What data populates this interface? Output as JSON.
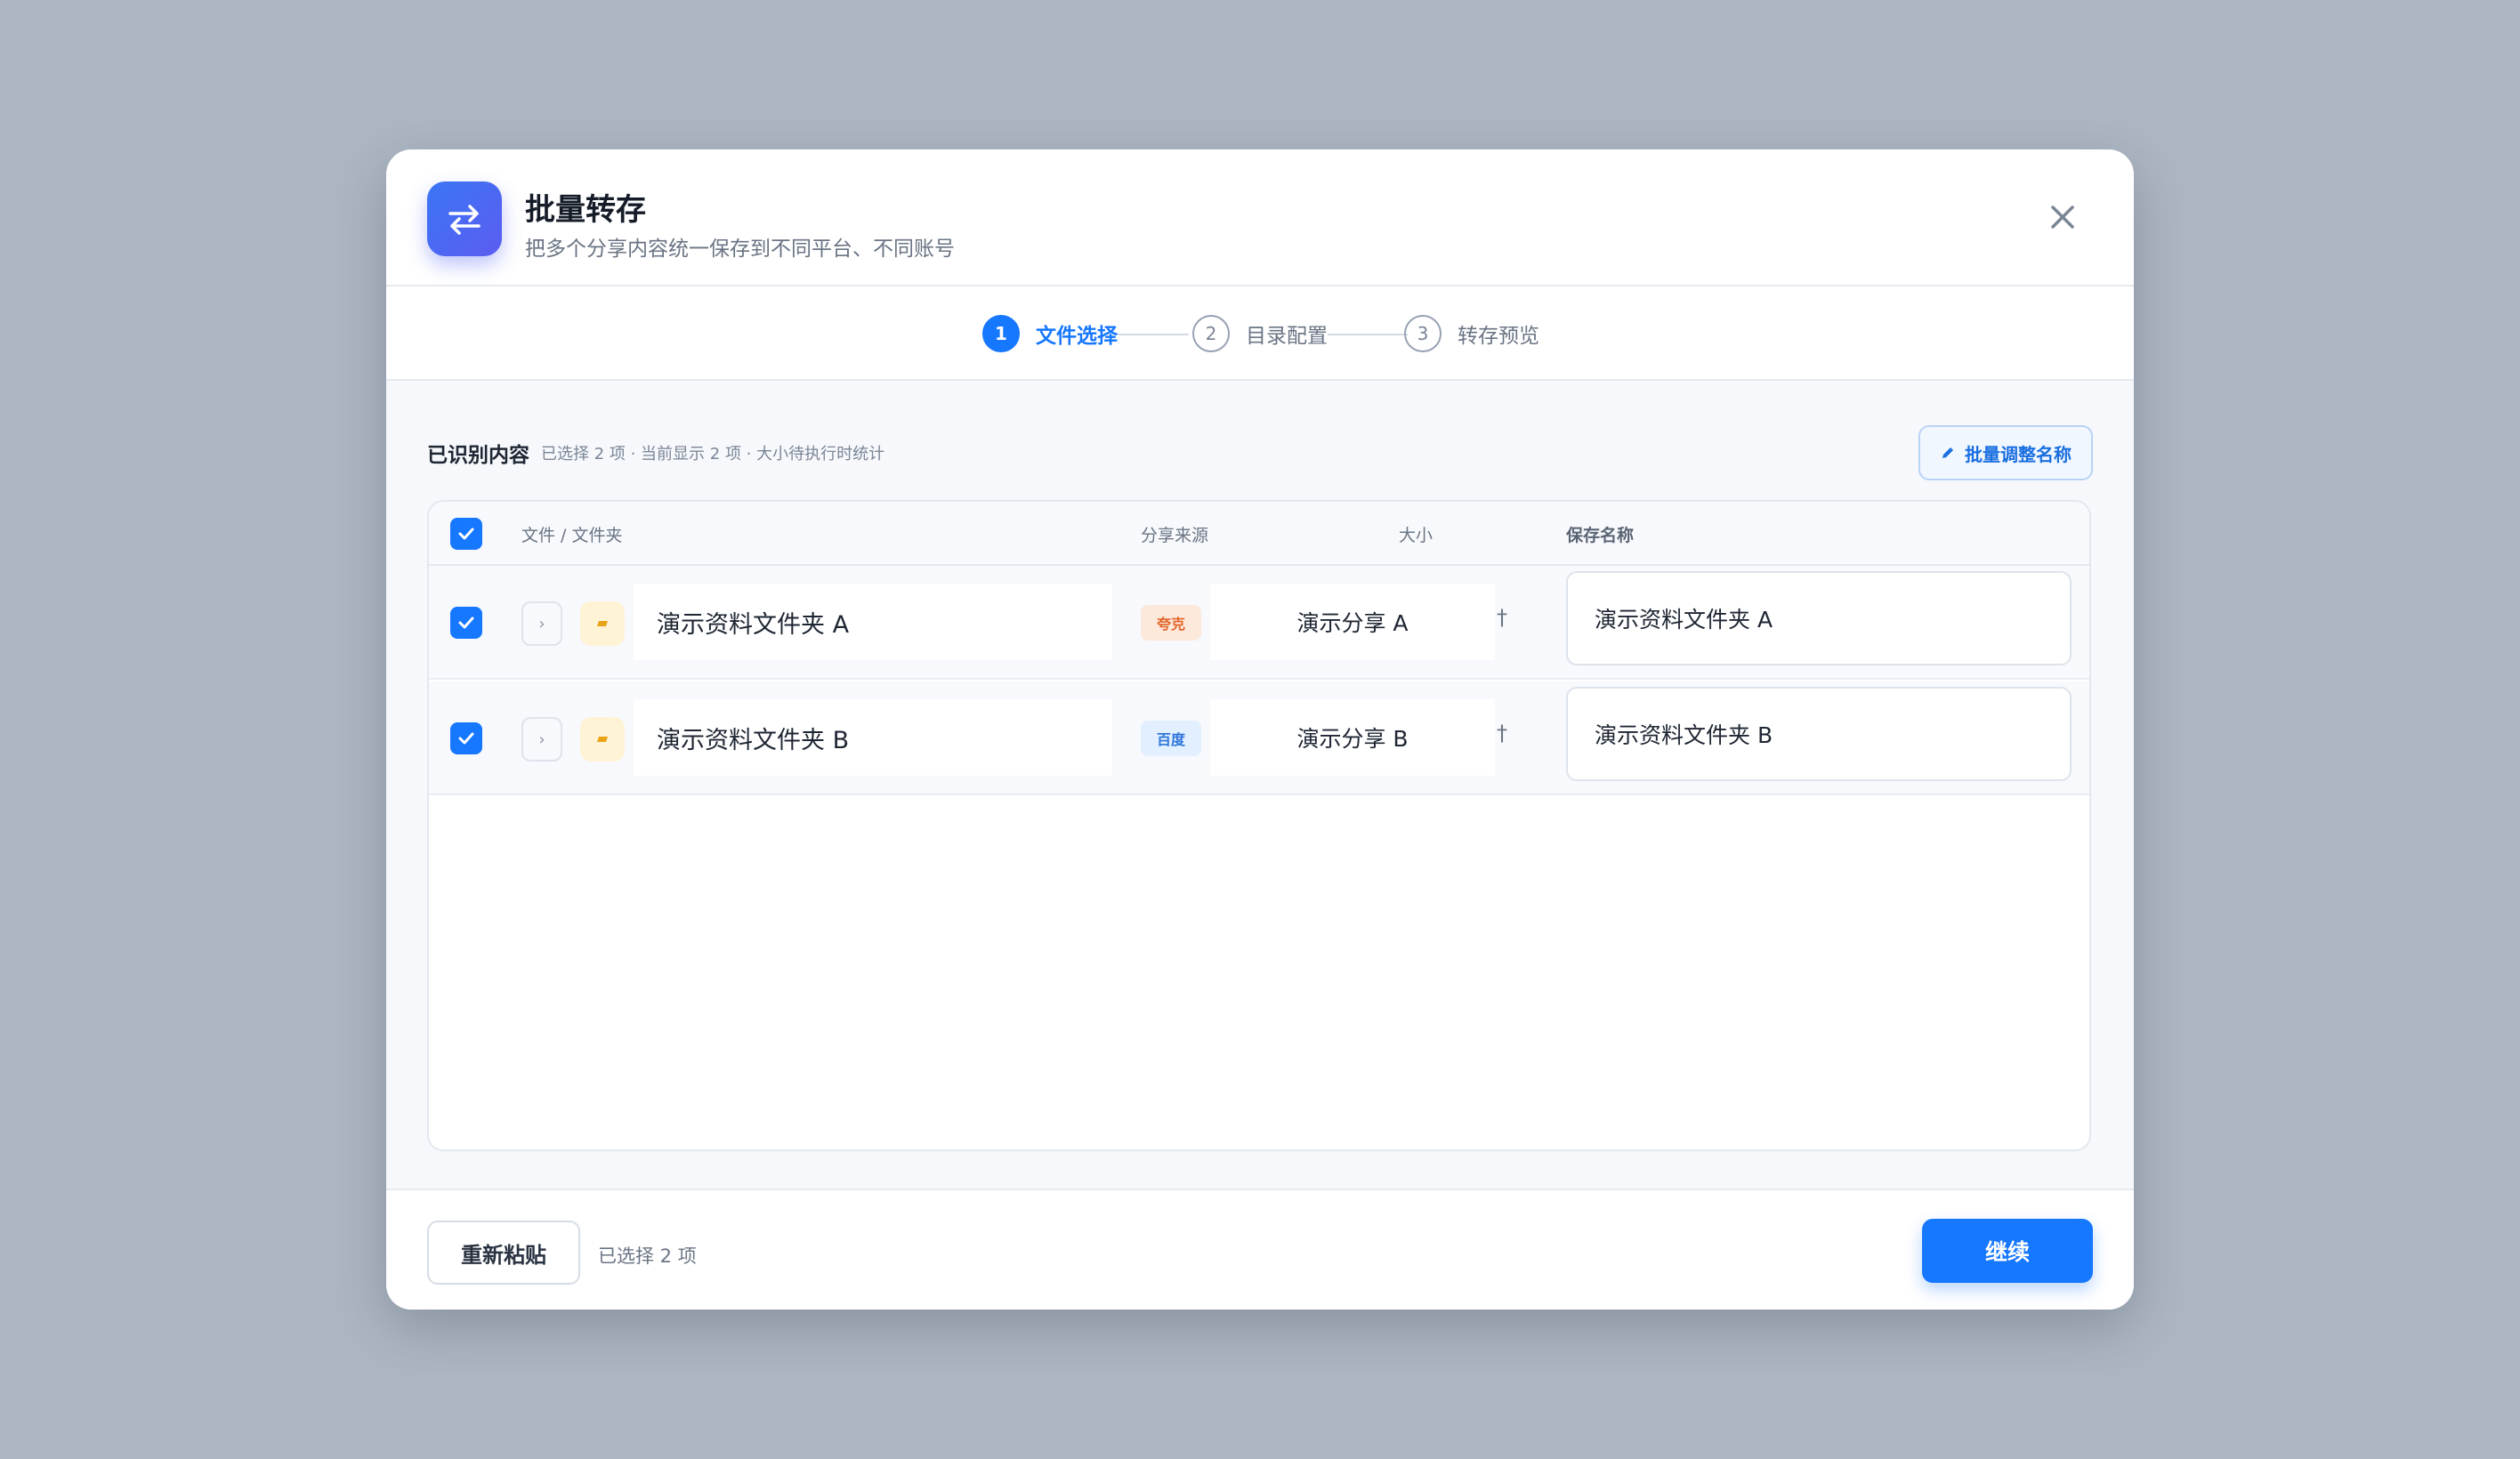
{
  "header": {
    "title": "批量转存",
    "subtitle": "把多个分享内容统一保存到不同平台、不同账号",
    "app_icon": "transfer-arrows-icon",
    "close_icon": "close-icon"
  },
  "steps": [
    {
      "number": "1",
      "label": "文件选择",
      "active": true
    },
    {
      "number": "2",
      "label": "目录配置",
      "active": false
    },
    {
      "number": "3",
      "label": "转存预览",
      "active": false
    }
  ],
  "section": {
    "title": "已识别内容",
    "meta": "已选择 2 项 · 当前显示 2 项 · 大小待执行时统计",
    "batch_rename_label": "批量调整名称",
    "batch_rename_icon": "pencil-icon"
  },
  "table": {
    "headers": {
      "file": "文件 / 文件夹",
      "source": "分享来源",
      "size": "大小",
      "save_name": "保存名称"
    },
    "rows": [
      {
        "checked": true,
        "name": "演示资料文件夹 A",
        "source_badge": "夸克",
        "share_name": "演示分享 A",
        "size": "†",
        "save_name": "演示资料文件夹 A"
      },
      {
        "checked": true,
        "name": "演示资料文件夹 B",
        "source_badge": "百度",
        "share_name": "演示分享 B",
        "size": "†",
        "save_name": "演示资料文件夹 B"
      }
    ]
  },
  "footer": {
    "repaste_label": "重新粘贴",
    "status": "已选择 2 项",
    "continue_label": "继续"
  },
  "colors": {
    "accent": "#1677ff",
    "backdrop": "#adb7c3",
    "quark_badge": "#e2672b",
    "baidu_badge": "#2c74d9",
    "folder": "#e8a317"
  }
}
